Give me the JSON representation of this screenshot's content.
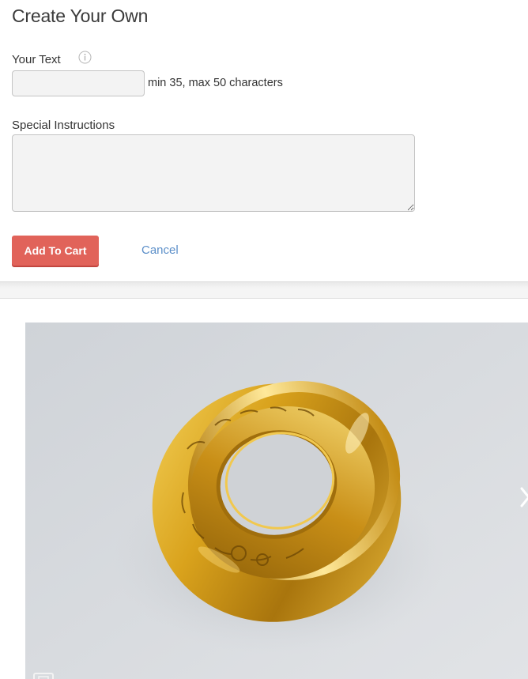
{
  "form": {
    "title": "Create Your Own",
    "your_text_label": "Your Text",
    "info_icon": "info-circle-icon",
    "your_text_value": "",
    "your_text_placeholder": "",
    "hint": "min 35, max 50 characters",
    "special_label": "Special Instructions",
    "special_value": "",
    "special_placeholder": "",
    "add_to_cart_label": "Add To Cart",
    "cancel_label": "Cancel"
  },
  "gallery": {
    "next_icon": "chevron-right-icon",
    "expand_icon": "expand-icon",
    "image_subject": "gold engraved mobius ring"
  },
  "colors": {
    "button": "#e1635a",
    "link": "#5c8fc9",
    "input_bg": "#f3f3f3"
  }
}
